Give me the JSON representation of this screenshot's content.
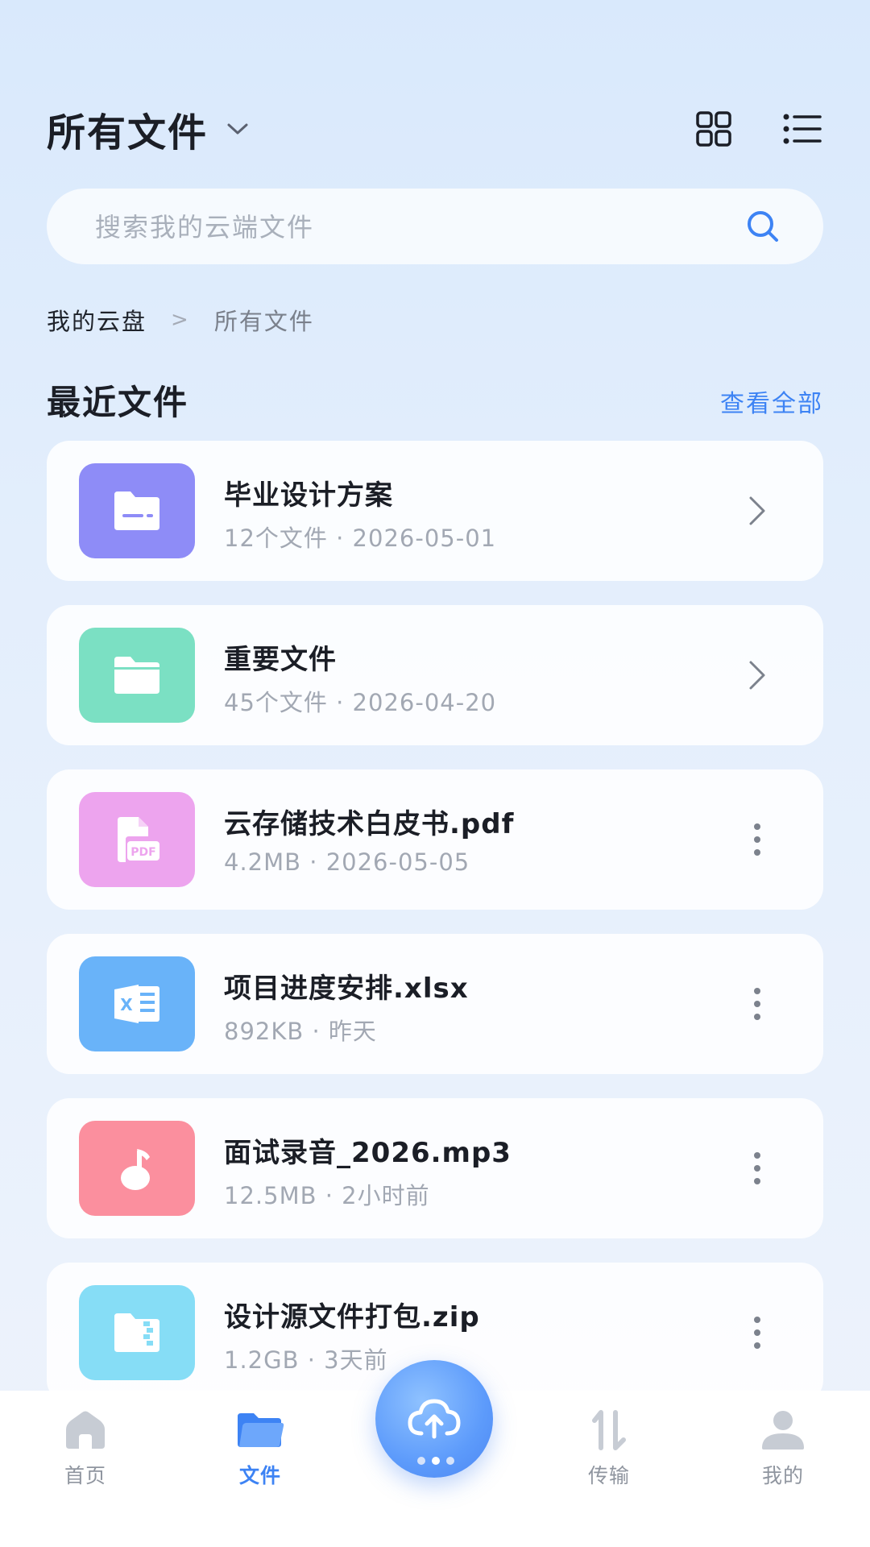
{
  "header": {
    "title": "所有文件",
    "title_chevron_icon": "chevron-down-icon",
    "grid_view_icon": "grid-view-icon",
    "list_view_icon": "list-view-icon"
  },
  "search": {
    "placeholder": "搜索我的云端文件",
    "value": "",
    "icon": "search-icon"
  },
  "breadcrumb": {
    "root": "我的云盘",
    "separator": ">",
    "current": "所有文件"
  },
  "recent": {
    "title": "最近文件",
    "view_all": "查看全部",
    "items": [
      {
        "name": "毕业设计方案",
        "meta": "12个文件 · 2026-05-01",
        "type": "folder",
        "icon": "folder-shared-icon",
        "color": "#8e8cf7",
        "action": "chevron-right-icon"
      },
      {
        "name": "重要文件",
        "meta": "45个文件 · 2026-04-20",
        "type": "folder",
        "icon": "folder-icon",
        "color": "#7be0c3",
        "action": "chevron-right-icon"
      },
      {
        "name": "云存储技术白皮书.pdf",
        "meta": "4.2MB · 2026-05-05",
        "type": "pdf",
        "icon": "pdf-file-icon",
        "color": "#eda4ee",
        "action": "more-vertical-icon"
      },
      {
        "name": "项目进度安排.xlsx",
        "meta": "892KB · 昨天",
        "type": "xlsx",
        "icon": "excel-file-icon",
        "color": "#69b3f9",
        "action": "more-vertical-icon"
      },
      {
        "name": "面试录音_2026.mp3",
        "meta": "12.5MB · 2小时前",
        "type": "mp3",
        "icon": "audio-file-icon",
        "color": "#fb8f9e",
        "action": "more-vertical-icon"
      },
      {
        "name": "设计源文件打包.zip",
        "meta": "1.2GB · 3天前",
        "type": "zip",
        "icon": "zip-file-icon",
        "color": "#86ddf6",
        "action": "more-vertical-icon"
      }
    ]
  },
  "bottom_nav": {
    "items": [
      {
        "label": "首页",
        "icon": "home-icon",
        "active": false
      },
      {
        "label": "文件",
        "icon": "files-icon",
        "active": true
      },
      {
        "label": "传输",
        "icon": "transfer-icon",
        "active": false
      },
      {
        "label": "我的",
        "icon": "profile-icon",
        "active": false
      }
    ],
    "upload_icon": "cloud-upload-icon"
  },
  "colors": {
    "accent": "#3d83f4",
    "text_primary": "#1b1e26",
    "text_secondary": "#a2a8b3"
  }
}
